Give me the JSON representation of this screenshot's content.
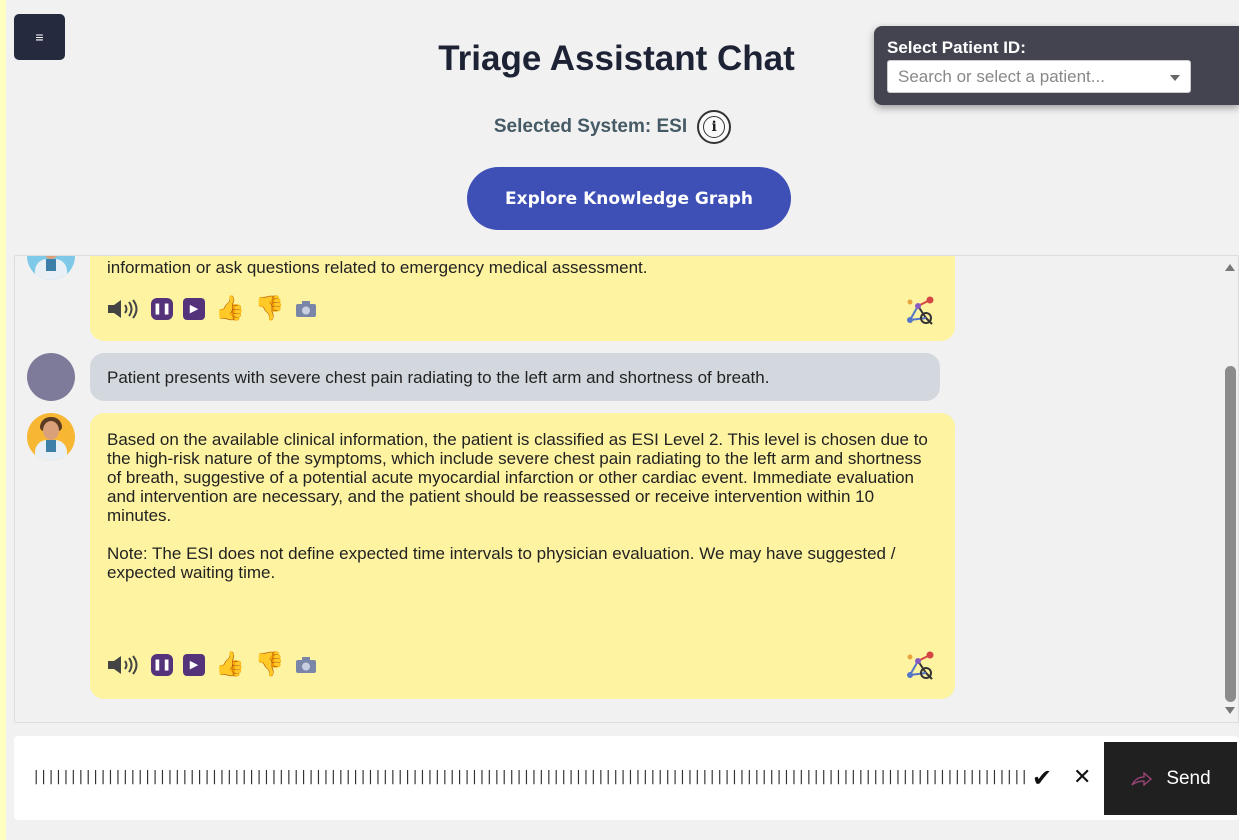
{
  "header": {
    "menu_icon": "hamburger-icon",
    "menu_glyph": "≡",
    "title": "Triage Assistant Chat",
    "system_label": "Selected System: ESI",
    "info_icon": "info-icon",
    "info_glyph": "i",
    "kg_button": "Explore Knowledge Graph"
  },
  "patient": {
    "label": "Select Patient ID:",
    "placeholder": "Search or select a patient..."
  },
  "messages": [
    {
      "role": "bot",
      "text": "information or ask questions related to emergency medical assessment."
    },
    {
      "role": "user",
      "text": "Patient presents with severe chest pain radiating to the left arm and shortness of breath."
    },
    {
      "role": "bot",
      "paragraphs": [
        "Based on the available clinical information, the patient is classified as ESI Level 2. This level is chosen due to the high-risk nature of the symptoms, which include severe chest pain radiating to the left arm and shortness of breath, suggestive of a potential acute myocardial infarction or other cardiac event. Immediate evaluation and intervention are necessary, and the patient should be reassessed or receive intervention within 10 minutes.",
        "Note: The ESI does not define expected time intervals to physician evaluation. We may have suggested / expected waiting time."
      ]
    }
  ],
  "toolbar_icons": [
    "speaker-icon",
    "pause-icon",
    "play-icon",
    "thumbs-up-icon",
    "thumbs-down-icon",
    "camera-icon",
    "knowledge-graph-icon"
  ],
  "toolbar_glyphs": {
    "pause": "❚❚",
    "play": "▶",
    "thumbs_up": "👍",
    "thumbs_down": "👎"
  },
  "input": {
    "waveform": "|||||||||||||||||||||||||||||||||||||||||||||||||||||||||||||||||||||||||||||||||||||||||||||||||||||||||||||||||||||||||||||||||||||||||||||||||||||||||||||||||||||||||||||||||||||||||||||||||||||||||||||||||||||||||||||||||||||||||||||||||||||||||||||||||||||||||||||",
    "check_glyph": "✔",
    "cancel_glyph": "✕",
    "send_label": "Send"
  },
  "colors": {
    "bot_bubble": "#fdf3a0",
    "user_bubble": "#d3d8de",
    "accent_button": "#3e4fb6",
    "menu_button": "#262a3f"
  }
}
